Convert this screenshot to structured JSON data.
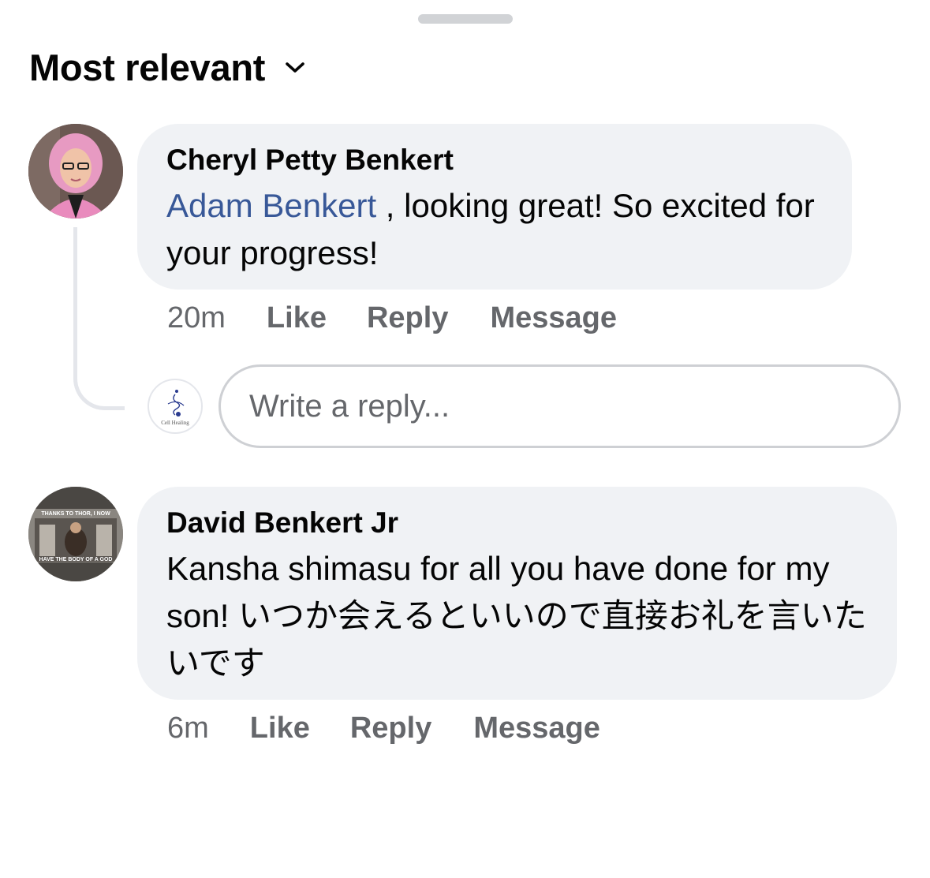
{
  "sort": {
    "label": "Most relevant"
  },
  "comments": [
    {
      "author": "Cheryl Petty Benkert",
      "mention": "Adam Benkert",
      "text": " , looking great! So excited for your progress!",
      "time": "20m",
      "actions": {
        "like": "Like",
        "reply": "Reply",
        "message": "Message"
      }
    },
    {
      "author": "David Benkert Jr",
      "text": "Kansha shimasu for all you have done for my son! いつか会えるといいので直接お礼を言いたいです",
      "time": "6m",
      "actions": {
        "like": "Like",
        "reply": "Reply",
        "message": "Message"
      },
      "avatar_text": {
        "top": "THANKS TO THOR, I NOW",
        "bottom": "HAVE THE BODY OF A GOD"
      }
    }
  ],
  "reply_box": {
    "placeholder": "Write a reply...",
    "avatar_caption": "Cell Healing"
  },
  "colors": {
    "mention": "#385898",
    "bubble": "#f0f2f5",
    "meta": "#65676b"
  }
}
